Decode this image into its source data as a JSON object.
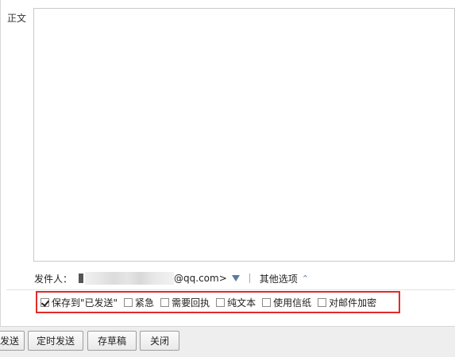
{
  "compose": {
    "body_label": "正文"
  },
  "sender": {
    "label": "发件人：",
    "email_domain": "@qq.com>",
    "other_options": "其他选项"
  },
  "options": [
    {
      "label": "保存到\"已发送\"",
      "checked": true
    },
    {
      "label": "紧急",
      "checked": false
    },
    {
      "label": "需要回执",
      "checked": false
    },
    {
      "label": "纯文本",
      "checked": false
    },
    {
      "label": "使用信纸",
      "checked": false
    },
    {
      "label": "对邮件加密",
      "checked": false
    }
  ],
  "toolbar": {
    "send": "发送",
    "timed_send": "定时发送",
    "save_draft": "存草稿",
    "close": "关闭"
  },
  "colors": {
    "highlight": "#e12b2b",
    "accent": "#5b7aa0"
  }
}
